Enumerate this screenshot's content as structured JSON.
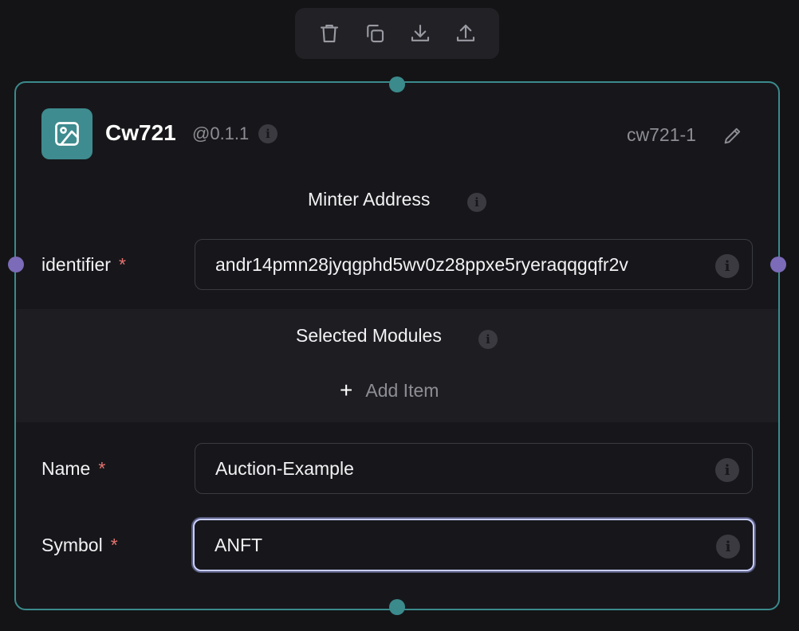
{
  "toolbar": {
    "actions": [
      {
        "name": "delete",
        "icon": "trash-icon"
      },
      {
        "name": "duplicate",
        "icon": "copy-icon"
      },
      {
        "name": "download",
        "icon": "download-icon"
      },
      {
        "name": "upload",
        "icon": "upload-icon"
      }
    ]
  },
  "node": {
    "title": "Cw721",
    "version": "@0.1.1",
    "id": "cw721-1",
    "icon": "image-icon",
    "accent_color": "#3e8c8f"
  },
  "sections": {
    "minter_address": "Minter Address",
    "selected_modules": "Selected Modules"
  },
  "fields": {
    "identifier": {
      "label": "identifier",
      "required": "*",
      "value": "andr14pmn28jyqgphd5wv0z28ppxe5ryeraqqgqfr2v"
    },
    "name": {
      "label": "Name",
      "required": "*",
      "value": "Auction-Example"
    },
    "symbol": {
      "label": "Symbol",
      "required": "*",
      "value": "ANFT"
    }
  },
  "modules": {
    "add_item_label": "Add Item"
  }
}
